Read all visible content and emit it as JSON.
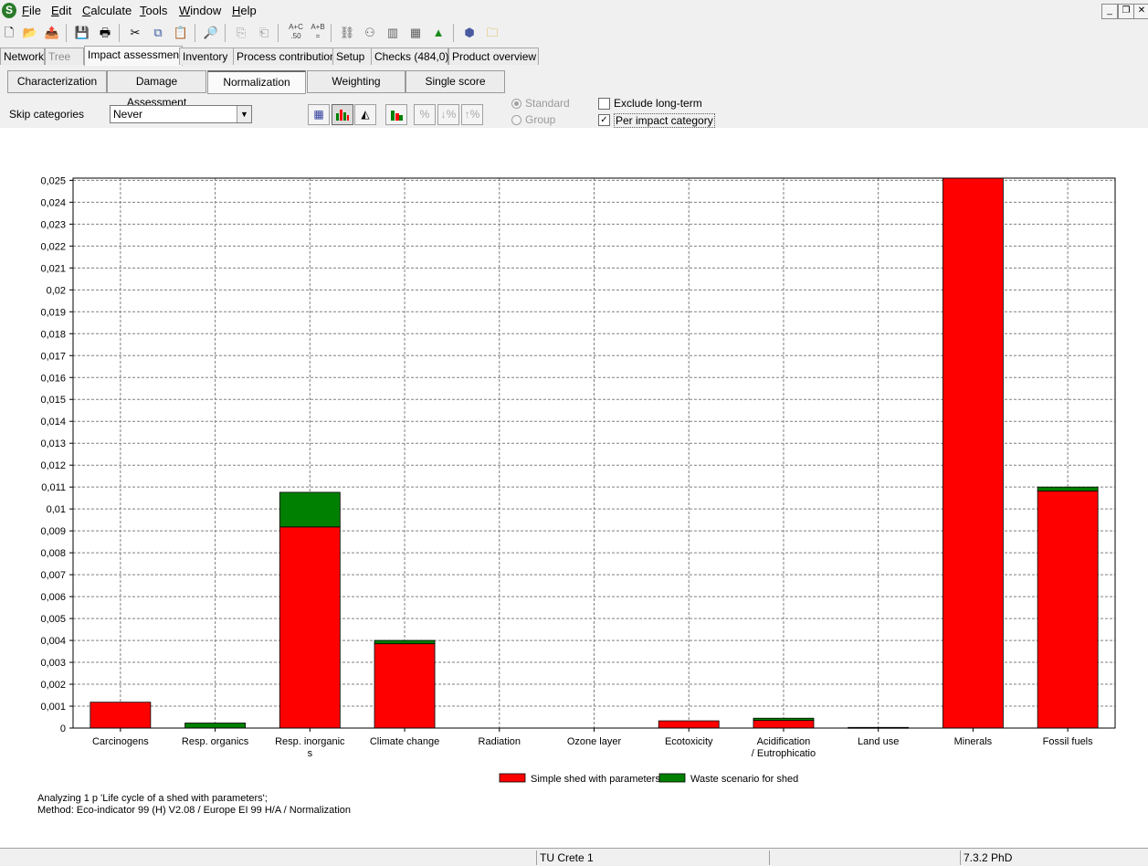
{
  "menu": {
    "items": [
      {
        "label": "File",
        "ul": "F",
        "rest": "ile"
      },
      {
        "label": "Edit",
        "ul": "E",
        "rest": "dit"
      },
      {
        "label": "Calculate",
        "ul": "C",
        "rest": "alculate"
      },
      {
        "label": "Tools",
        "ul": "T",
        "rest": "ools"
      },
      {
        "label": "Window",
        "ul": "W",
        "rest": "indow"
      },
      {
        "label": "Help",
        "ul": "H",
        "rest": "elp"
      }
    ],
    "logo_letter": "S"
  },
  "toolbar": {
    "icons": [
      "new-document-icon",
      "open-folder-icon",
      "open-project-icon",
      "save-icon",
      "print-icon",
      "cut-icon",
      "copy-icon",
      "paste-icon",
      "find-icon",
      "copy-to-icon",
      "paste-from-icon",
      "calc-a-plus-c-icon",
      "calc-a-plus-b-icon",
      "network-icon",
      "tree-icon",
      "bar-chart-icon",
      "comparison-chart-icon",
      "distribution-icon",
      "package-icon",
      "folder-icon"
    ],
    "calc_ac_top": "A+C",
    "calc_ac_bottom": ".50",
    "calc_ab_top": "A+B",
    "calc_ab_bottom": "="
  },
  "tabs": {
    "network": "Network",
    "tree": "Tree",
    "impact_assessment": "Impact assessment",
    "inventory": "Inventory",
    "process_contribution": "Process contribution",
    "setup": "Setup",
    "checks": "Checks (484,0)",
    "product_overview": "Product overview"
  },
  "subtabs": {
    "characterization": "Characterization",
    "damage_assessment": "Damage Assessment",
    "normalization": "Normalization",
    "weighting": "Weighting",
    "single_score": "Single score"
  },
  "options": {
    "skip_label": "Skip categories",
    "skip_value": "Never",
    "standard": "Standard",
    "group": "Group",
    "exclude_long_term": "Exclude long-term",
    "per_impact_category": "Per impact category",
    "exclude_checked": false,
    "per_impact_checked": true
  },
  "chart_data": {
    "type": "bar",
    "stacked": true,
    "categories": [
      "Carcinogens",
      "Resp. organics",
      "Resp. inorganics",
      "Climate change",
      "Radiation",
      "Ozone layer",
      "Ecotoxicity",
      "Acidification / Eutrophication",
      "Land use",
      "Minerals",
      "Fossil fuels"
    ],
    "category_lines": [
      [
        "Carcinogens"
      ],
      [
        "Resp. organics"
      ],
      [
        "Resp. inorganic",
        "s"
      ],
      [
        "Climate change"
      ],
      [
        "Radiation"
      ],
      [
        "Ozone layer"
      ],
      [
        "Ecotoxicity"
      ],
      [
        "Acidification",
        "/ Eutrophicatio"
      ],
      [
        "Land use"
      ],
      [
        "Minerals"
      ],
      [
        "Fossil fuels"
      ]
    ],
    "series": [
      {
        "name": "Simple shed with parameters",
        "color": "#ff0000",
        "values": [
          0.00118,
          0.0,
          0.00918,
          0.00385,
          0.0,
          0.0,
          0.00033,
          0.00035,
          0.0,
          0.0251,
          0.01082
        ]
      },
      {
        "name": "Waste scenario for shed",
        "color": "#008000",
        "values": [
          0.0,
          0.00023,
          0.00158,
          0.00015,
          0.0,
          0.0,
          0.0,
          0.0001,
          3e-05,
          0.0,
          0.00018
        ]
      }
    ],
    "ylim": [
      0,
      0.0251
    ],
    "yticks": [
      "0",
      "0,001",
      "0,002",
      "0,003",
      "0,004",
      "0,005",
      "0,006",
      "0,007",
      "0,008",
      "0,009",
      "0,01",
      "0,011",
      "0,012",
      "0,013",
      "0,014",
      "0,015",
      "0,016",
      "0,017",
      "0,018",
      "0,019",
      "0,02",
      "0,021",
      "0,022",
      "0,023",
      "0,024",
      "0,025"
    ],
    "grid": true,
    "legend_position": "bottom-center"
  },
  "info": {
    "line1": "Analyzing 1 p 'Life cycle of a shed with parameters';",
    "line2": "Method: Eco-indicator 99 (H) V2.08 / Europe EI 99 H/A / Normalization"
  },
  "status": {
    "project": "TU Crete 1",
    "version": "7.3.2 PhD"
  }
}
